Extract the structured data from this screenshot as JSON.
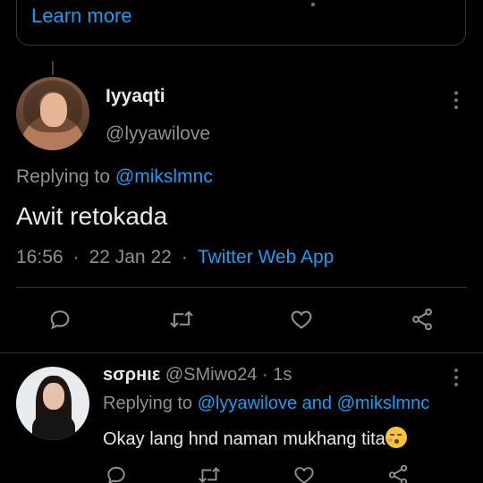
{
  "card": {
    "link_label": "Learn more"
  },
  "tweet": {
    "display_name": "Iyyaqti",
    "handle": "@lyyawilove",
    "replying_prefix": "Replying to",
    "replying_to": "@mikslmnc",
    "text": "Awit retokada",
    "time": "16:56",
    "separator": "·",
    "date": "22 Jan 22",
    "source": "Twitter Web App"
  },
  "actions": [
    {
      "icon": "reply-icon"
    },
    {
      "icon": "retweet-icon"
    },
    {
      "icon": "like-icon"
    },
    {
      "icon": "share-icon"
    }
  ],
  "reply": {
    "display_name": "ѕσρнιε",
    "handle": "@SMiwo24",
    "separator": "·",
    "age": "1s",
    "replying_prefix": "Replying to",
    "mention_1": "@lyyawilove",
    "and": "and",
    "mention_2": "@mikslmnc",
    "text": "Okay lang hnd naman mukhang tita"
  },
  "colors": {
    "background": "#000000",
    "accent": "#1d9bf0",
    "muted": "#8b9196",
    "text": "#e7e9ea",
    "divider": "#2f3336"
  }
}
